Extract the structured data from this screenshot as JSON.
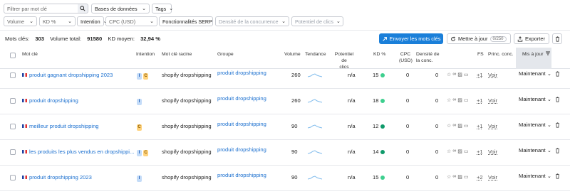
{
  "filters": {
    "search_placeholder": "Filtrer par mot clé",
    "databases": "Bases de données",
    "tags": "Tags",
    "volume": "Volume",
    "kd": "KD %",
    "intention": "Intention",
    "cpc": "CPC (USD)",
    "serp": "Fonctionnalités SERP",
    "densite": "Densité de la concurrence",
    "potentiel": "Potentiel de clics"
  },
  "stats": {
    "mots_cles_label": "Mots clés:",
    "mots_cles_value": "303",
    "volume_label": "Volume total:",
    "volume_value": "91580",
    "kd_label": "KD moyen:",
    "kd_value": "32,94 %"
  },
  "toolbar": {
    "send_label": "Envoyer les mots clés",
    "update_label": "Mettre à jour",
    "update_badge": "0/250",
    "export_label": "Exporter"
  },
  "headers": {
    "mot_cle": "Mot clé",
    "intention": "Intention",
    "racine": "Mot clé racine",
    "groupe": "Groupe",
    "volume": "Volume",
    "tendance": "Tendance",
    "potentiel_1": "Potentiel de",
    "potentiel_2": "clics",
    "kd": "KD %",
    "cpc_1": "CPC",
    "cpc_2": "(USD)",
    "densite_1": "Densité de",
    "densite_2": "la conc.",
    "fs": "FS",
    "princ": "Princ. conc.",
    "maj": "Mis à jour"
  },
  "rows": [
    {
      "keyword": "produit gagnant dropshipping 2023",
      "intents": [
        "I",
        "C"
      ],
      "root": "shopify dropshipping",
      "group": "produit dropshipping",
      "volume": "260",
      "potential": "n/a",
      "kd": "15",
      "kd_color": "#3dcf8e",
      "cpc": "0",
      "density": "0",
      "plus": "+1",
      "voir": "Voir",
      "updated": "Maintenant"
    },
    {
      "keyword": "produit dropshipping",
      "intents": [
        "I"
      ],
      "root": "shopify dropshipping",
      "group": "produit dropshipping",
      "volume": "260",
      "potential": "n/a",
      "kd": "18",
      "kd_color": "#3dcf8e",
      "cpc": "0",
      "density": "0",
      "plus": "+1",
      "voir": "Voir",
      "updated": "Maintenant"
    },
    {
      "keyword": "meilleur produit dropshipping",
      "intents": [
        "C"
      ],
      "root": "shopify dropshipping",
      "group": "produit dropshipping",
      "volume": "90",
      "potential": "n/a",
      "kd": "12",
      "kd_color": "#0f9a6a",
      "cpc": "0",
      "density": "0",
      "plus": "+1",
      "voir": "Voir",
      "updated": "Maintenant"
    },
    {
      "keyword": "les produits les plus vendus en dropshippi...",
      "intents": [
        "I",
        "C"
      ],
      "root": "shopify dropshipping",
      "group": "produit dropshipping",
      "volume": "90",
      "potential": "n/a",
      "kd": "14",
      "kd_color": "#0f9a6a",
      "cpc": "0",
      "density": "0",
      "plus": "+1",
      "voir": "Voir",
      "updated": "Maintenant"
    },
    {
      "keyword": "produit dropshipping 2023",
      "intents": [
        "I"
      ],
      "root": "shopify dropshipping",
      "group": "produit dropshipping",
      "volume": "90",
      "potential": "n/a",
      "kd": "15",
      "kd_color": "#3dcf8e",
      "cpc": "0",
      "density": "0",
      "plus": "+2",
      "voir": "Voir",
      "updated": "Maintenant"
    }
  ],
  "icons": {
    "search": "search-icon",
    "send": "arrow-icon",
    "refresh": "refresh-icon",
    "export": "export-icon",
    "delete": "trash-icon",
    "sort": "sort-icon"
  }
}
